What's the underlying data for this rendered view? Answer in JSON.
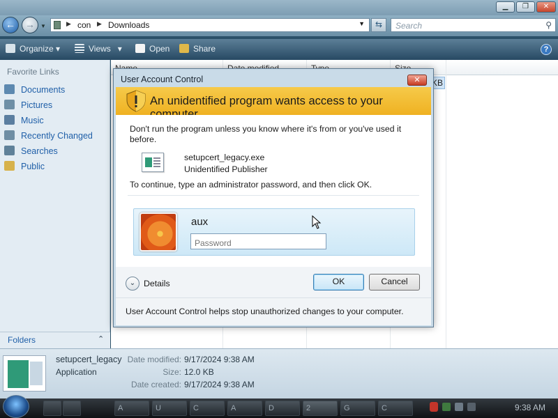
{
  "explorer": {
    "address": {
      "crumbs": [
        "con",
        "Downloads"
      ]
    },
    "search_placeholder": "Search",
    "toolbar": {
      "organize": "Organize",
      "views": "Views",
      "open": "Open",
      "share": "Share"
    },
    "nav": {
      "header": "Favorite Links",
      "links": [
        "Documents",
        "Pictures",
        "Music",
        "Recently Changed",
        "Searches",
        "Public"
      ],
      "folders": "Folders"
    },
    "columns": {
      "name": "Name",
      "date_modified": "Date modified",
      "type": "Type",
      "size": "Size"
    },
    "row_size_tail": "KB",
    "details": {
      "name": "setupcert_legacy",
      "kind": "Application",
      "date_modified_label": "Date modified:",
      "date_modified": "9/17/2024 9:38 AM",
      "size_label": "Size:",
      "size": "12.0 KB",
      "date_created_label": "Date created:",
      "date_created": "9/17/2024 9:38 AM"
    }
  },
  "taskbar": {
    "items": [
      "A",
      "U",
      "C",
      "A",
      "D",
      "2",
      "G",
      "C"
    ],
    "clock": "9:38 AM"
  },
  "uac": {
    "title": "User Account Control",
    "close_glyph": "✕",
    "heading": "An unidentified program wants access to your computer",
    "warning_line1": "Don't run the program unless you know where it's from or you've used it",
    "warning_line2": "before.",
    "program_name": "setupcert_legacy.exe",
    "publisher": "Unidentified Publisher",
    "instruction": "To continue, type an administrator password, and then click OK.",
    "user_name": "aux",
    "password_placeholder": "Password",
    "details_label": "Details",
    "ok_label": "OK",
    "cancel_label": "Cancel",
    "info": "User Account Control helps stop unauthorized changes to your computer."
  }
}
